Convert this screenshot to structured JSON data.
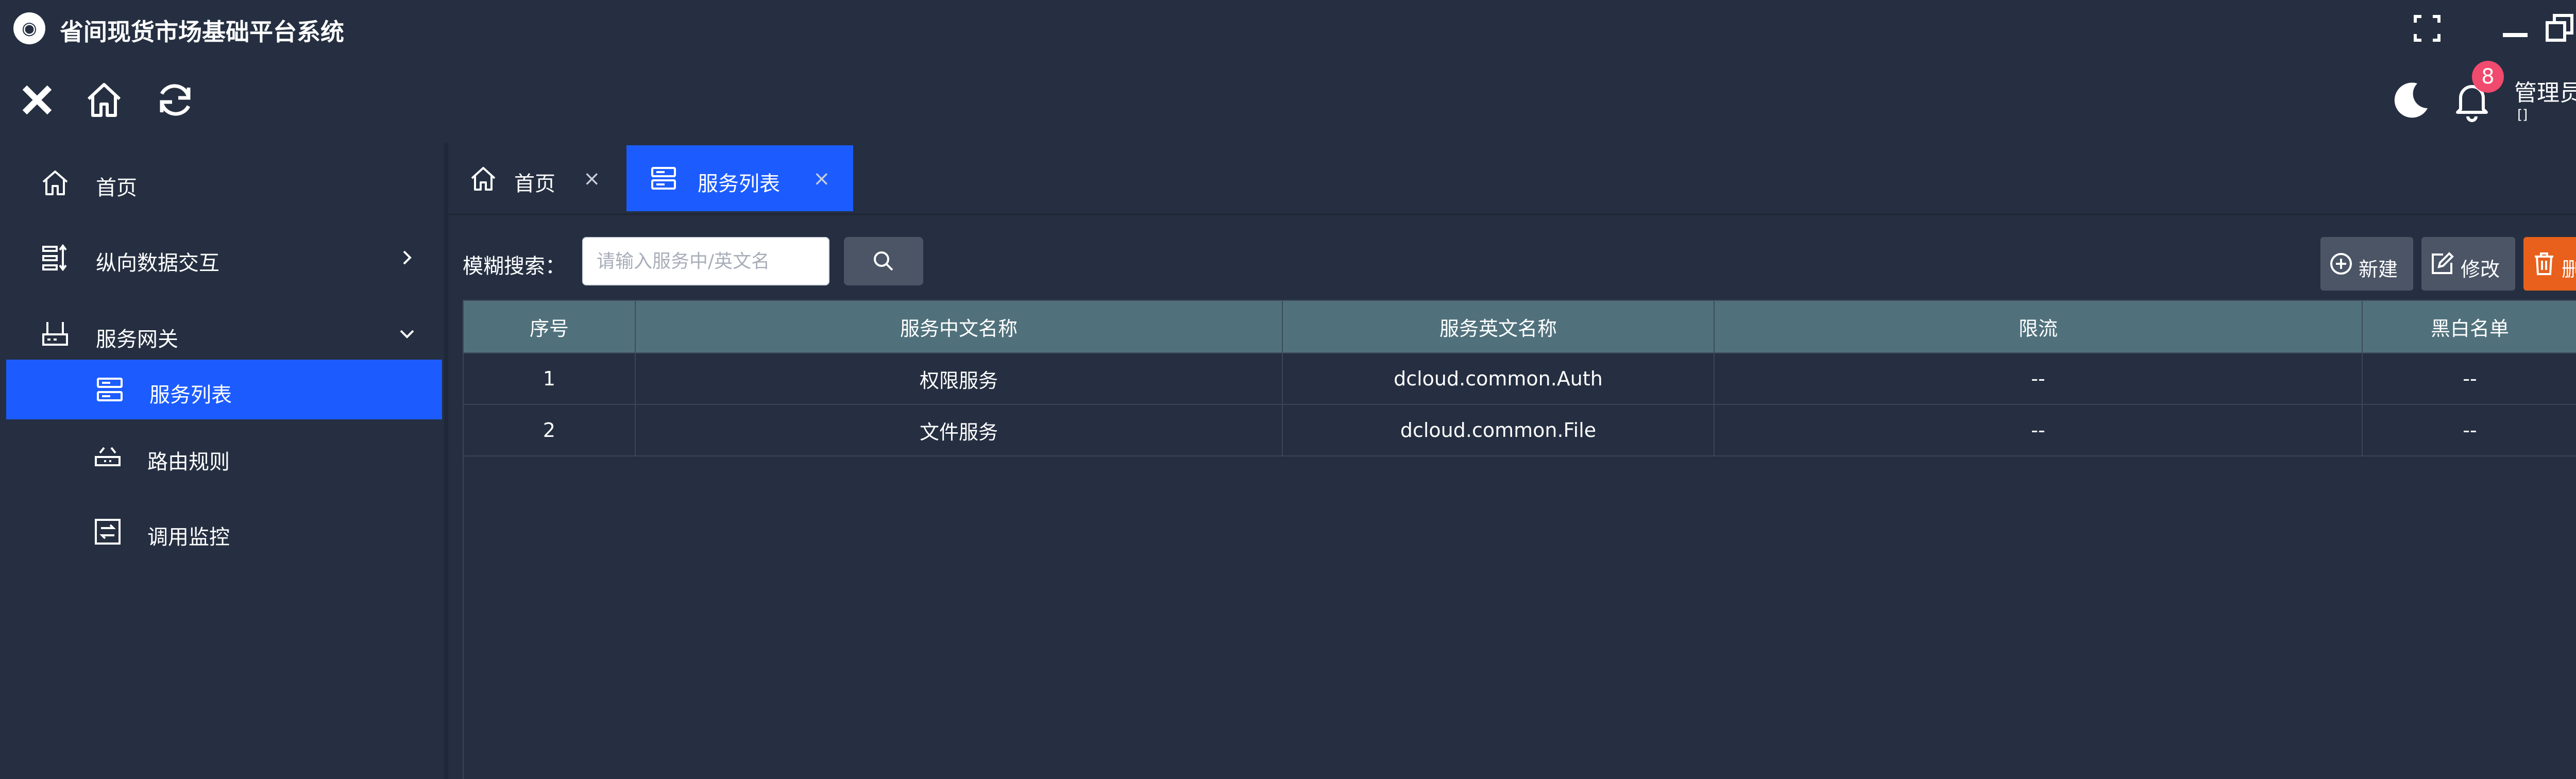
{
  "app": {
    "title": "省间现货市场基础平台系统"
  },
  "toolbar": {
    "badge_count": "8",
    "user_name": "管理员",
    "user_sub": "[]"
  },
  "sidebar": {
    "items": [
      {
        "label": "首页",
        "icon": "home-icon"
      },
      {
        "label": "纵向数据交互",
        "icon": "data-exchange-icon",
        "arrow": "chevron-right-icon"
      },
      {
        "label": "服务网关",
        "icon": "gateway-icon",
        "arrow": "chevron-down-icon"
      },
      {
        "label": "服务列表",
        "icon": "server-list-icon",
        "active": true
      },
      {
        "label": "路由规则",
        "icon": "router-icon"
      },
      {
        "label": "调用监控",
        "icon": "monitor-icon"
      }
    ]
  },
  "tabs": [
    {
      "label": "首页",
      "close": "×",
      "icon": "home-icon"
    },
    {
      "label": "服务列表",
      "close": "×",
      "icon": "server-list-icon",
      "active": true
    }
  ],
  "search": {
    "label": "模糊搜索：",
    "placeholder": "请输入服务中/英文名",
    "value": ""
  },
  "actions": {
    "new_label": "新建",
    "edit_label": "修改",
    "delete_label": "删除"
  },
  "table": {
    "columns": [
      "序号",
      "服务中文名称",
      "服务英文名称",
      "限流",
      "黑白名单"
    ],
    "rows": [
      [
        "1",
        "权限服务",
        "dcloud.common.Auth",
        "--",
        "--"
      ],
      [
        "2",
        "文件服务",
        "dcloud.common.File",
        "--",
        "--"
      ]
    ]
  },
  "colors": {
    "background": "#252f41",
    "accent": "#1c5cff",
    "table_header": "#50717c",
    "delete": "#e8601c",
    "badge": "#f04a6e"
  }
}
